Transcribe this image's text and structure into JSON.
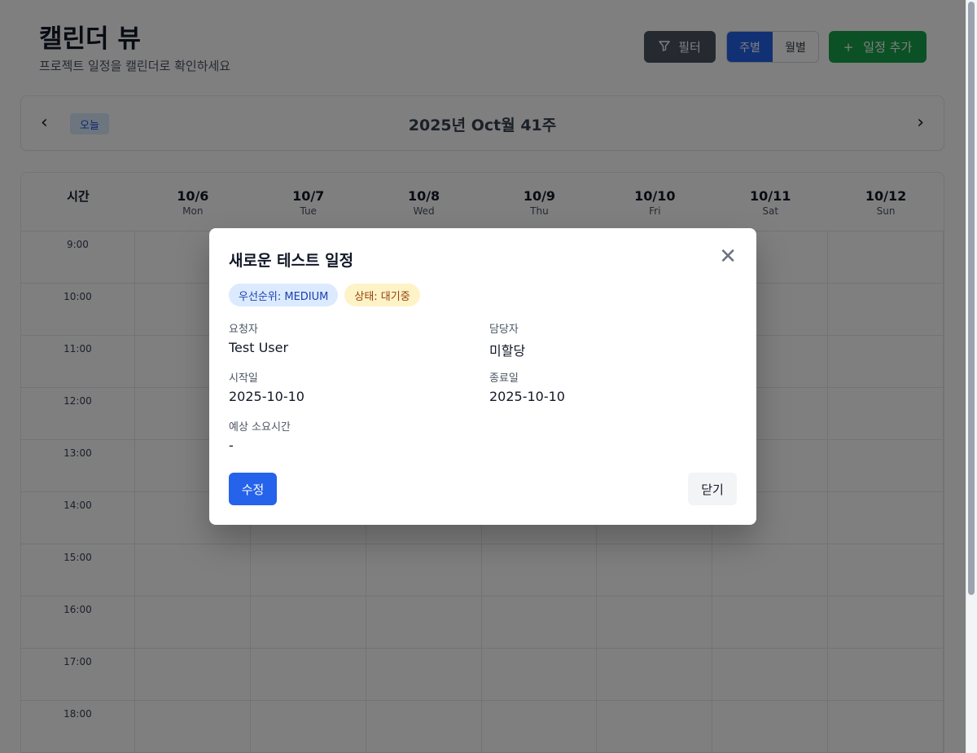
{
  "header": {
    "title": "캘린더 뷰",
    "subtitle": "프로젝트 일정을 캘린더로 확인하세요",
    "filter_label": "필터",
    "view_week": "주별",
    "view_month": "월별",
    "add_label": "일정 추가"
  },
  "nav": {
    "prev_icon": "‹",
    "today_label": "오늘",
    "period_title": "2025년 Oct월 41주",
    "next_icon": "›"
  },
  "calendar": {
    "time_header": "시간",
    "days": [
      {
        "date": "10/6",
        "dow": "Mon"
      },
      {
        "date": "10/7",
        "dow": "Tue"
      },
      {
        "date": "10/8",
        "dow": "Wed"
      },
      {
        "date": "10/9",
        "dow": "Thu"
      },
      {
        "date": "10/10",
        "dow": "Fri"
      },
      {
        "date": "10/11",
        "dow": "Sat"
      },
      {
        "date": "10/12",
        "dow": "Sun"
      }
    ],
    "times": [
      "9:00",
      "10:00",
      "11:00",
      "12:00",
      "13:00",
      "14:00",
      "15:00",
      "16:00",
      "17:00",
      "18:00"
    ]
  },
  "modal": {
    "title": "새로운 테스트 일정",
    "priority_badge": "우선순위: MEDIUM",
    "status_badge": "상태: 대기중",
    "requester_label": "요청자",
    "requester_value": "Test User",
    "assignee_label": "담당자",
    "assignee_value": "미할당",
    "start_label": "시작일",
    "start_value": "2025-10-10",
    "end_label": "종료일",
    "end_value": "2025-10-10",
    "duration_label": "예상 소요시간",
    "duration_value": "-",
    "edit_label": "수정",
    "close_label": "닫기"
  },
  "colors": {
    "primary": "#2563eb",
    "success": "#16a34a",
    "filter": "#4b5563",
    "priority_bg": "#dbeafe",
    "status_bg": "#fef3c7"
  },
  "icons": {
    "filter": "filter-icon",
    "add": "plus-icon",
    "close": "close-icon",
    "prev": "chevron-left-icon",
    "next": "chevron-right-icon"
  }
}
